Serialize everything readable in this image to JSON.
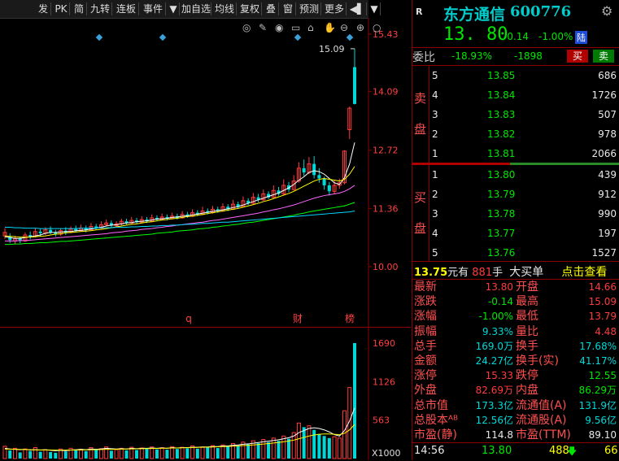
{
  "toolbar": {
    "items": [
      "发",
      "PK",
      "简",
      "九转",
      "连板",
      "事件",
      "▼",
      "加自选",
      "均线",
      "复权",
      "叠",
      "窗",
      "预测",
      "更多",
      "◀▌",
      "▼"
    ]
  },
  "kline": {
    "y_labels": [
      "15.43",
      "14.09",
      "12.72",
      "11.36",
      "10.00"
    ],
    "high_label": "15.09",
    "markers": [
      "q",
      "财",
      "榜"
    ]
  },
  "volume": {
    "y_labels": [
      "1690",
      "1126",
      "563"
    ],
    "unit": "X1000"
  },
  "chart_data": {
    "type": "candlestick",
    "ylim": [
      10.0,
      15.43
    ],
    "y_ticks": [
      15.43,
      14.09,
      12.72,
      11.36,
      10.0
    ],
    "annotated_high": 15.09,
    "vol_ticks": [
      1690,
      1126,
      563
    ],
    "vol_unit": "X1000",
    "candles": [
      [
        10.72,
        10.8,
        10.65,
        10.9
      ],
      [
        10.7,
        10.62,
        10.55,
        10.78
      ],
      [
        10.6,
        10.66,
        10.52,
        10.72
      ],
      [
        10.66,
        10.6,
        10.55,
        10.7
      ],
      [
        10.6,
        10.74,
        10.58,
        10.8
      ],
      [
        10.74,
        10.7,
        10.64,
        10.82
      ],
      [
        10.7,
        10.82,
        10.68,
        10.9
      ],
      [
        10.82,
        10.78,
        10.72,
        10.88
      ],
      [
        10.78,
        10.86,
        10.74,
        10.92
      ],
      [
        10.86,
        10.8,
        10.76,
        10.94
      ],
      [
        10.8,
        10.76,
        10.7,
        10.86
      ],
      [
        10.76,
        10.84,
        10.72,
        10.9
      ],
      [
        10.84,
        10.8,
        10.74,
        10.92
      ],
      [
        10.8,
        10.88,
        10.78,
        10.94
      ],
      [
        10.88,
        10.84,
        10.8,
        10.96
      ],
      [
        10.84,
        10.9,
        10.82,
        10.98
      ],
      [
        10.9,
        10.86,
        10.8,
        10.96
      ],
      [
        10.86,
        10.94,
        10.84,
        11.02
      ],
      [
        10.94,
        10.9,
        10.86,
        11.0
      ],
      [
        10.9,
        10.98,
        10.88,
        11.06
      ],
      [
        10.98,
        11.02,
        10.94,
        11.1
      ],
      [
        11.02,
        10.96,
        10.92,
        11.08
      ],
      [
        10.96,
        11.0,
        10.92,
        11.06
      ],
      [
        11.0,
        11.06,
        10.96,
        11.12
      ],
      [
        11.06,
        11.02,
        10.98,
        11.12
      ],
      [
        11.02,
        11.08,
        11.0,
        11.16
      ],
      [
        11.08,
        11.04,
        11.0,
        11.14
      ],
      [
        11.04,
        11.1,
        11.02,
        11.18
      ],
      [
        11.1,
        11.06,
        11.02,
        11.16
      ],
      [
        11.06,
        11.14,
        11.04,
        11.22
      ],
      [
        11.14,
        11.1,
        11.06,
        11.2
      ],
      [
        11.1,
        11.16,
        11.08,
        11.24
      ],
      [
        11.16,
        11.12,
        11.08,
        11.22
      ],
      [
        11.12,
        11.18,
        11.1,
        11.26
      ],
      [
        11.18,
        11.14,
        11.1,
        11.24
      ],
      [
        11.14,
        11.22,
        11.12,
        11.3
      ],
      [
        11.22,
        11.18,
        11.14,
        11.28
      ],
      [
        11.18,
        11.26,
        11.16,
        11.34
      ],
      [
        11.26,
        11.22,
        11.18,
        11.32
      ],
      [
        11.22,
        11.3,
        11.2,
        11.4
      ],
      [
        11.3,
        11.26,
        11.22,
        11.36
      ],
      [
        11.26,
        11.34,
        11.24,
        11.42
      ],
      [
        11.34,
        11.3,
        11.26,
        11.4
      ],
      [
        11.3,
        11.4,
        11.28,
        11.48
      ],
      [
        11.4,
        11.34,
        11.3,
        11.46
      ],
      [
        11.34,
        11.46,
        11.32,
        11.56
      ],
      [
        11.46,
        11.4,
        11.36,
        11.52
      ],
      [
        11.4,
        11.54,
        11.38,
        11.64
      ],
      [
        11.54,
        11.48,
        11.44,
        11.6
      ],
      [
        11.48,
        11.62,
        11.46,
        11.72
      ],
      [
        11.62,
        11.56,
        11.5,
        11.7
      ],
      [
        11.56,
        11.7,
        11.54,
        11.8
      ],
      [
        11.7,
        11.62,
        11.58,
        11.76
      ],
      [
        11.62,
        11.78,
        11.6,
        11.9
      ],
      [
        11.78,
        11.7,
        11.66,
        11.86
      ],
      [
        11.7,
        11.9,
        11.68,
        12.04
      ],
      [
        11.9,
        11.8,
        11.74,
        11.98
      ],
      [
        11.8,
        12.0,
        11.78,
        12.14
      ],
      [
        12.0,
        12.3,
        11.96,
        12.44
      ],
      [
        12.3,
        12.2,
        12.12,
        12.5
      ],
      [
        12.2,
        12.4,
        12.16,
        12.56
      ],
      [
        12.4,
        12.14,
        12.06,
        12.58
      ],
      [
        12.14,
        12.06,
        11.96,
        12.3
      ],
      [
        12.06,
        11.9,
        11.8,
        12.1
      ],
      [
        11.9,
        11.76,
        11.66,
        11.98
      ],
      [
        11.76,
        11.9,
        11.7,
        12.02
      ],
      [
        11.9,
        11.96,
        11.82,
        12.06
      ],
      [
        11.96,
        12.7,
        11.92,
        12.72
      ],
      [
        13.2,
        13.7,
        12.98,
        13.74
      ],
      [
        14.66,
        13.8,
        13.79,
        15.09
      ]
    ],
    "ma_lines": [
      {
        "color": "#ffffff",
        "values": [
          10.7,
          10.68,
          10.66,
          10.66,
          10.68,
          10.7,
          10.72,
          10.74,
          10.78,
          10.8,
          10.8,
          10.81,
          10.82,
          10.82,
          10.84,
          10.85,
          10.86,
          10.88,
          10.9,
          10.92,
          10.95,
          10.97,
          10.98,
          11.0,
          11.02,
          11.03,
          11.05,
          11.06,
          11.07,
          11.09,
          11.11,
          11.12,
          11.13,
          11.15,
          11.16,
          11.18,
          11.19,
          11.21,
          11.23,
          11.25,
          11.27,
          11.29,
          11.31,
          11.33,
          11.35,
          11.38,
          11.4,
          11.44,
          11.48,
          11.52,
          11.56,
          11.6,
          11.64,
          11.68,
          11.72,
          11.78,
          11.84,
          11.92,
          12.02,
          12.1,
          12.2,
          12.24,
          12.22,
          12.16,
          12.06,
          11.96,
          11.92,
          12.08,
          12.4,
          12.9
        ]
      },
      {
        "color": "#ffff00",
        "values": [
          10.72,
          10.71,
          10.7,
          10.69,
          10.69,
          10.69,
          10.7,
          10.71,
          10.72,
          10.74,
          10.76,
          10.77,
          10.79,
          10.8,
          10.81,
          10.82,
          10.83,
          10.84,
          10.86,
          10.87,
          10.89,
          10.91,
          10.93,
          10.95,
          10.97,
          10.99,
          11.0,
          11.02,
          11.04,
          11.05,
          11.07,
          11.09,
          11.1,
          11.12,
          11.13,
          11.15,
          11.17,
          11.18,
          11.2,
          11.22,
          11.24,
          11.26,
          11.28,
          11.3,
          11.32,
          11.34,
          11.36,
          11.39,
          11.42,
          11.45,
          11.48,
          11.52,
          11.55,
          11.59,
          11.63,
          11.67,
          11.71,
          11.76,
          11.82,
          11.88,
          11.94,
          12.0,
          12.04,
          12.06,
          12.04,
          12.02,
          12.0,
          12.04,
          12.16,
          12.34
        ]
      },
      {
        "color": "#ff66ff",
        "values": [
          10.6,
          10.6,
          10.6,
          10.61,
          10.61,
          10.62,
          10.63,
          10.64,
          10.65,
          10.66,
          10.67,
          10.68,
          10.69,
          10.7,
          10.71,
          10.72,
          10.73,
          10.74,
          10.75,
          10.76,
          10.77,
          10.79,
          10.8,
          10.81,
          10.83,
          10.84,
          10.85,
          10.87,
          10.88,
          10.89,
          10.91,
          10.92,
          10.94,
          10.95,
          10.97,
          10.98,
          11.0,
          11.01,
          11.03,
          11.04,
          11.06,
          11.08,
          11.09,
          11.11,
          11.13,
          11.15,
          11.17,
          11.19,
          11.21,
          11.23,
          11.25,
          11.28,
          11.3,
          11.33,
          11.35,
          11.38,
          11.41,
          11.44,
          11.48,
          11.52,
          11.56,
          11.6,
          11.63,
          11.66,
          11.68,
          11.7,
          11.72,
          11.76,
          11.82,
          11.9
        ]
      },
      {
        "color": "#00ff00",
        "values": [
          10.52,
          10.52,
          10.53,
          10.53,
          10.54,
          10.54,
          10.55,
          10.56,
          10.56,
          10.57,
          10.58,
          10.59,
          10.59,
          10.6,
          10.61,
          10.62,
          10.63,
          10.64,
          10.65,
          10.66,
          10.67,
          10.68,
          10.69,
          10.7,
          10.71,
          10.72,
          10.73,
          10.74,
          10.75,
          10.76,
          10.78,
          10.79,
          10.8,
          10.81,
          10.83,
          10.84,
          10.85,
          10.86,
          10.88,
          10.89,
          10.9,
          10.92,
          10.93,
          10.95,
          10.96,
          10.98,
          10.99,
          11.01,
          11.03,
          11.04,
          11.06,
          11.08,
          11.1,
          11.12,
          11.14,
          11.16,
          11.18,
          11.2,
          11.23,
          11.25,
          11.28,
          11.3,
          11.32,
          11.34,
          11.36,
          11.38,
          11.4,
          11.42,
          11.46,
          11.5
        ]
      },
      {
        "color": "#00d8ff",
        "values": [
          10.92,
          10.92,
          10.91,
          10.91,
          10.9,
          10.9,
          10.9,
          10.89,
          10.89,
          10.89,
          10.89,
          10.89,
          10.89,
          10.89,
          10.89,
          10.9,
          10.9,
          10.9,
          10.9,
          10.91,
          10.91,
          10.91,
          10.92,
          10.92,
          10.92,
          10.93,
          10.93,
          10.94,
          10.94,
          10.95,
          10.95,
          10.96,
          10.96,
          10.97,
          10.97,
          10.98,
          10.99,
          10.99,
          11.0,
          11.01,
          11.01,
          11.02,
          11.03,
          11.04,
          11.04,
          11.05,
          11.06,
          11.07,
          11.08,
          11.09,
          11.1,
          11.11,
          11.12,
          11.13,
          11.14,
          11.15,
          11.16,
          11.17,
          11.18,
          11.19,
          11.2,
          11.21,
          11.22,
          11.23,
          11.24,
          11.25,
          11.26,
          11.27,
          11.28,
          11.3
        ]
      }
    ],
    "volumes": [
      180,
      120,
      150,
      90,
      140,
      110,
      160,
      100,
      130,
      95,
      85,
      140,
      105,
      150,
      120,
      135,
      110,
      160,
      125,
      145,
      170,
      115,
      130,
      150,
      120,
      165,
      125,
      155,
      140,
      170,
      135,
      160,
      130,
      175,
      140,
      165,
      150,
      185,
      145,
      170,
      160,
      190,
      155,
      200,
      175,
      220,
      185,
      240,
      210,
      260,
      225,
      280,
      240,
      300,
      260,
      330,
      290,
      380,
      520,
      460,
      480,
      420,
      360,
      330,
      300,
      320,
      300,
      700,
      1040,
      1690
    ],
    "vol_ma": [
      {
        "color": "#ffffff",
        "values": [
          150,
          140,
          135,
          130,
          135,
          125,
          130,
          125,
          130,
          120,
          115,
          120,
          115,
          125,
          130,
          135,
          130,
          140,
          135,
          140,
          150,
          145,
          140,
          145,
          140,
          150,
          145,
          150,
          150,
          155,
          150,
          155,
          150,
          160,
          155,
          160,
          160,
          165,
          165,
          170,
          170,
          175,
          175,
          185,
          185,
          195,
          200,
          210,
          215,
          225,
          235,
          245,
          255,
          265,
          275,
          290,
          305,
          330,
          380,
          410,
          440,
          450,
          440,
          420,
          390,
          350,
          330,
          410,
          550,
          740
        ]
      },
      {
        "color": "#ffff00",
        "values": [
          140,
          138,
          136,
          134,
          132,
          130,
          128,
          127,
          126,
          125,
          124,
          124,
          124,
          125,
          126,
          127,
          128,
          130,
          131,
          133,
          135,
          136,
          137,
          139,
          140,
          142,
          143,
          145,
          146,
          148,
          149,
          151,
          152,
          154,
          155,
          157,
          159,
          161,
          163,
          165,
          167,
          170,
          172,
          175,
          178,
          182,
          186,
          190,
          195,
          200,
          206,
          213,
          220,
          228,
          236,
          246,
          257,
          270,
          290,
          310,
          330,
          345,
          355,
          360,
          360,
          355,
          350,
          370,
          420,
          500
        ]
      }
    ]
  },
  "quote": {
    "badge": "R",
    "name": "东方通信",
    "code": "600776",
    "price": "13. 80",
    "change": "-0.14",
    "change_pct": "-1.00%",
    "market_tag": "陆",
    "weibi_label": "委比",
    "weibi_pct": "-18.93%",
    "weibi_diff": "-1898",
    "buy_btn": "买",
    "sell_btn": "卖",
    "sell_side_label": [
      "卖",
      "盘"
    ],
    "buy_side_label": [
      "买",
      "盘"
    ],
    "asks": [
      {
        "lvl": "5",
        "price": "13.85",
        "vol": "686"
      },
      {
        "lvl": "4",
        "price": "13.84",
        "vol": "1726"
      },
      {
        "lvl": "3",
        "price": "13.83",
        "vol": "507"
      },
      {
        "lvl": "2",
        "price": "13.82",
        "vol": "978"
      },
      {
        "lvl": "1",
        "price": "13.81",
        "vol": "2066"
      }
    ],
    "bids": [
      {
        "lvl": "1",
        "price": "13.80",
        "vol": "439"
      },
      {
        "lvl": "2",
        "price": "13.79",
        "vol": "912"
      },
      {
        "lvl": "3",
        "price": "13.78",
        "vol": "990"
      },
      {
        "lvl": "4",
        "price": "13.77",
        "vol": "197"
      },
      {
        "lvl": "5",
        "price": "13.76",
        "vol": "1527"
      }
    ],
    "bigorder": {
      "price": "13.75",
      "unit1": "元有",
      "qty": "881",
      "unit2": "手",
      "label": "大买单",
      "link": "点击查看"
    },
    "stats": [
      {
        "l1": "最新",
        "v1": "13.80",
        "c1": "red",
        "l2": "开盘",
        "v2": "14.66",
        "c2": "red"
      },
      {
        "l1": "涨跌",
        "v1": "-0.14",
        "c1": "green",
        "l2": "最高",
        "v2": "15.09",
        "c2": "red"
      },
      {
        "l1": "涨幅",
        "v1": "-1.00%",
        "c1": "green",
        "l2": "最低",
        "v2": "13.79",
        "c2": "red"
      },
      {
        "l1": "振幅",
        "v1": "9.33%",
        "c1": "cyan",
        "l2": "量比",
        "v2": "4.48",
        "c2": "red"
      },
      {
        "l1": "总手",
        "v1": "169.0万",
        "c1": "cyan",
        "l2": "换手",
        "v2": "17.68%",
        "c2": "cyan"
      },
      {
        "l1": "金额",
        "v1": "24.27亿",
        "c1": "cyan",
        "l2": "换手(实)",
        "v2": "41.17%",
        "c2": "cyan"
      },
      {
        "l1": "涨停",
        "v1": "15.33",
        "c1": "red",
        "l2": "跌停",
        "v2": "12.55",
        "c2": "green"
      },
      {
        "l1": "外盘",
        "v1": "82.69万",
        "c1": "red",
        "l2": "内盘",
        "v2": "86.29万",
        "c2": "green"
      },
      {
        "l1": "总市值",
        "v1": "173.3亿",
        "c1": "cyan",
        "l2": "流通值(A)",
        "v2": "131.9亿",
        "c2": "cyan"
      },
      {
        "l1": "总股本ᴬᴮ",
        "v1": "12.56亿",
        "c1": "cyan",
        "l2": "流通股(A)",
        "v2": "9.56亿",
        "c2": "cyan"
      },
      {
        "l1": "市盈(静)",
        "v1": "114.8",
        "c1": "white",
        "l2": "市盈(TTM)",
        "v2": "89.10",
        "c2": "white"
      }
    ],
    "tick": {
      "time": "14:56",
      "price": "13.80",
      "vol": "488",
      "arrow": "🡇",
      "num": "66"
    }
  }
}
